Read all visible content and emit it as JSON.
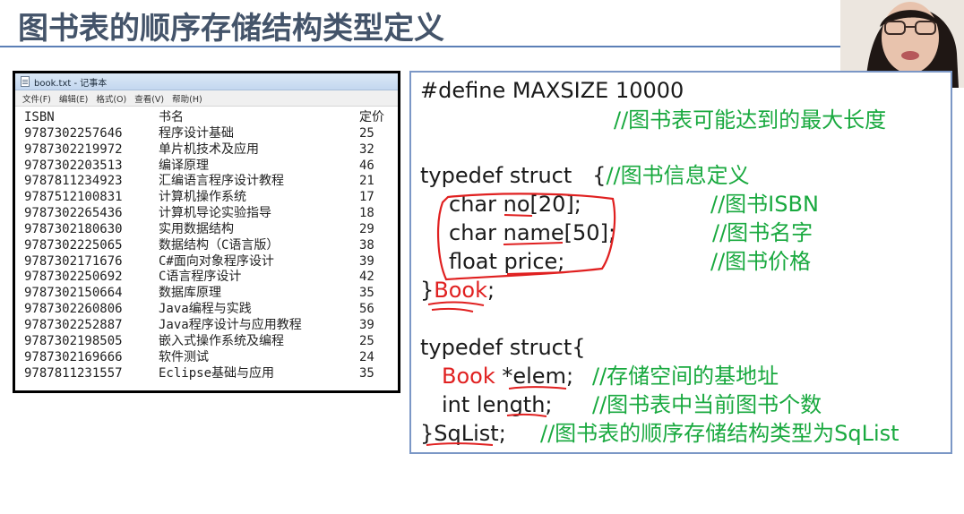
{
  "slide": {
    "title": "图书表的顺序存储结构类型定义"
  },
  "notepad": {
    "window_title": "book.txt - 记事本",
    "menu": [
      "文件(F)",
      "编辑(E)",
      "格式(O)",
      "查看(V)",
      "帮助(H)"
    ],
    "columns": [
      "ISBN",
      "书名",
      "定价"
    ],
    "rows": [
      [
        "9787302257646",
        "程序设计基础",
        "25"
      ],
      [
        "9787302219972",
        "单片机技术及应用",
        "32"
      ],
      [
        "9787302203513",
        "编译原理",
        "46"
      ],
      [
        "9787811234923",
        "汇编语言程序设计教程",
        "21"
      ],
      [
        "9787512100831",
        "计算机操作系统",
        "17"
      ],
      [
        "9787302265436",
        "计算机导论实验指导",
        "18"
      ],
      [
        "9787302180630",
        "实用数据结构",
        "29"
      ],
      [
        "9787302225065",
        "数据结构（C语言版）",
        "38"
      ],
      [
        "9787302171676",
        "C#面向对象程序设计",
        "39"
      ],
      [
        "9787302250692",
        "C语言程序设计",
        "42"
      ],
      [
        "9787302150664",
        "数据库原理",
        "35"
      ],
      [
        "9787302260806",
        "Java编程与实践",
        "56"
      ],
      [
        "9787302252887",
        "Java程序设计与应用教程",
        "39"
      ],
      [
        "9787302198505",
        "嵌入式操作系统及编程",
        "25"
      ],
      [
        "9787302169666",
        "软件测试",
        "24"
      ],
      [
        "9787811231557",
        "Eclipse基础与应用",
        "35"
      ]
    ]
  },
  "code": {
    "define_line": "#define MAXSIZE 10000",
    "define_comment": "//图书表可能达到的最大长度",
    "struct1_open": "typedef struct   {",
    "struct1_open_comment": "//图书信息定义",
    "field_no": "char no[20];",
    "field_no_comment": "//图书ISBN",
    "field_name": "char name[50];",
    "field_name_comment": "//图书名字",
    "field_price": "float price;",
    "field_price_comment": "//图书价格",
    "struct1_close": "}Book;",
    "struct2_open": "typedef struct{",
    "field_elem": "Book *elem;",
    "field_elem_comment": "//存储空间的基地址",
    "field_length": "int length;",
    "field_length_comment": "//图书表中当前图书个数",
    "struct2_close": "}SqList;",
    "struct2_close_comment": "//图书表的顺序存储结构类型为SqList"
  },
  "colors": {
    "title": "#44546a",
    "title_rule": "#5b7fb6",
    "panel_border": "#7b97c6",
    "comment": "#19a93f",
    "annotation": "#e02020"
  }
}
